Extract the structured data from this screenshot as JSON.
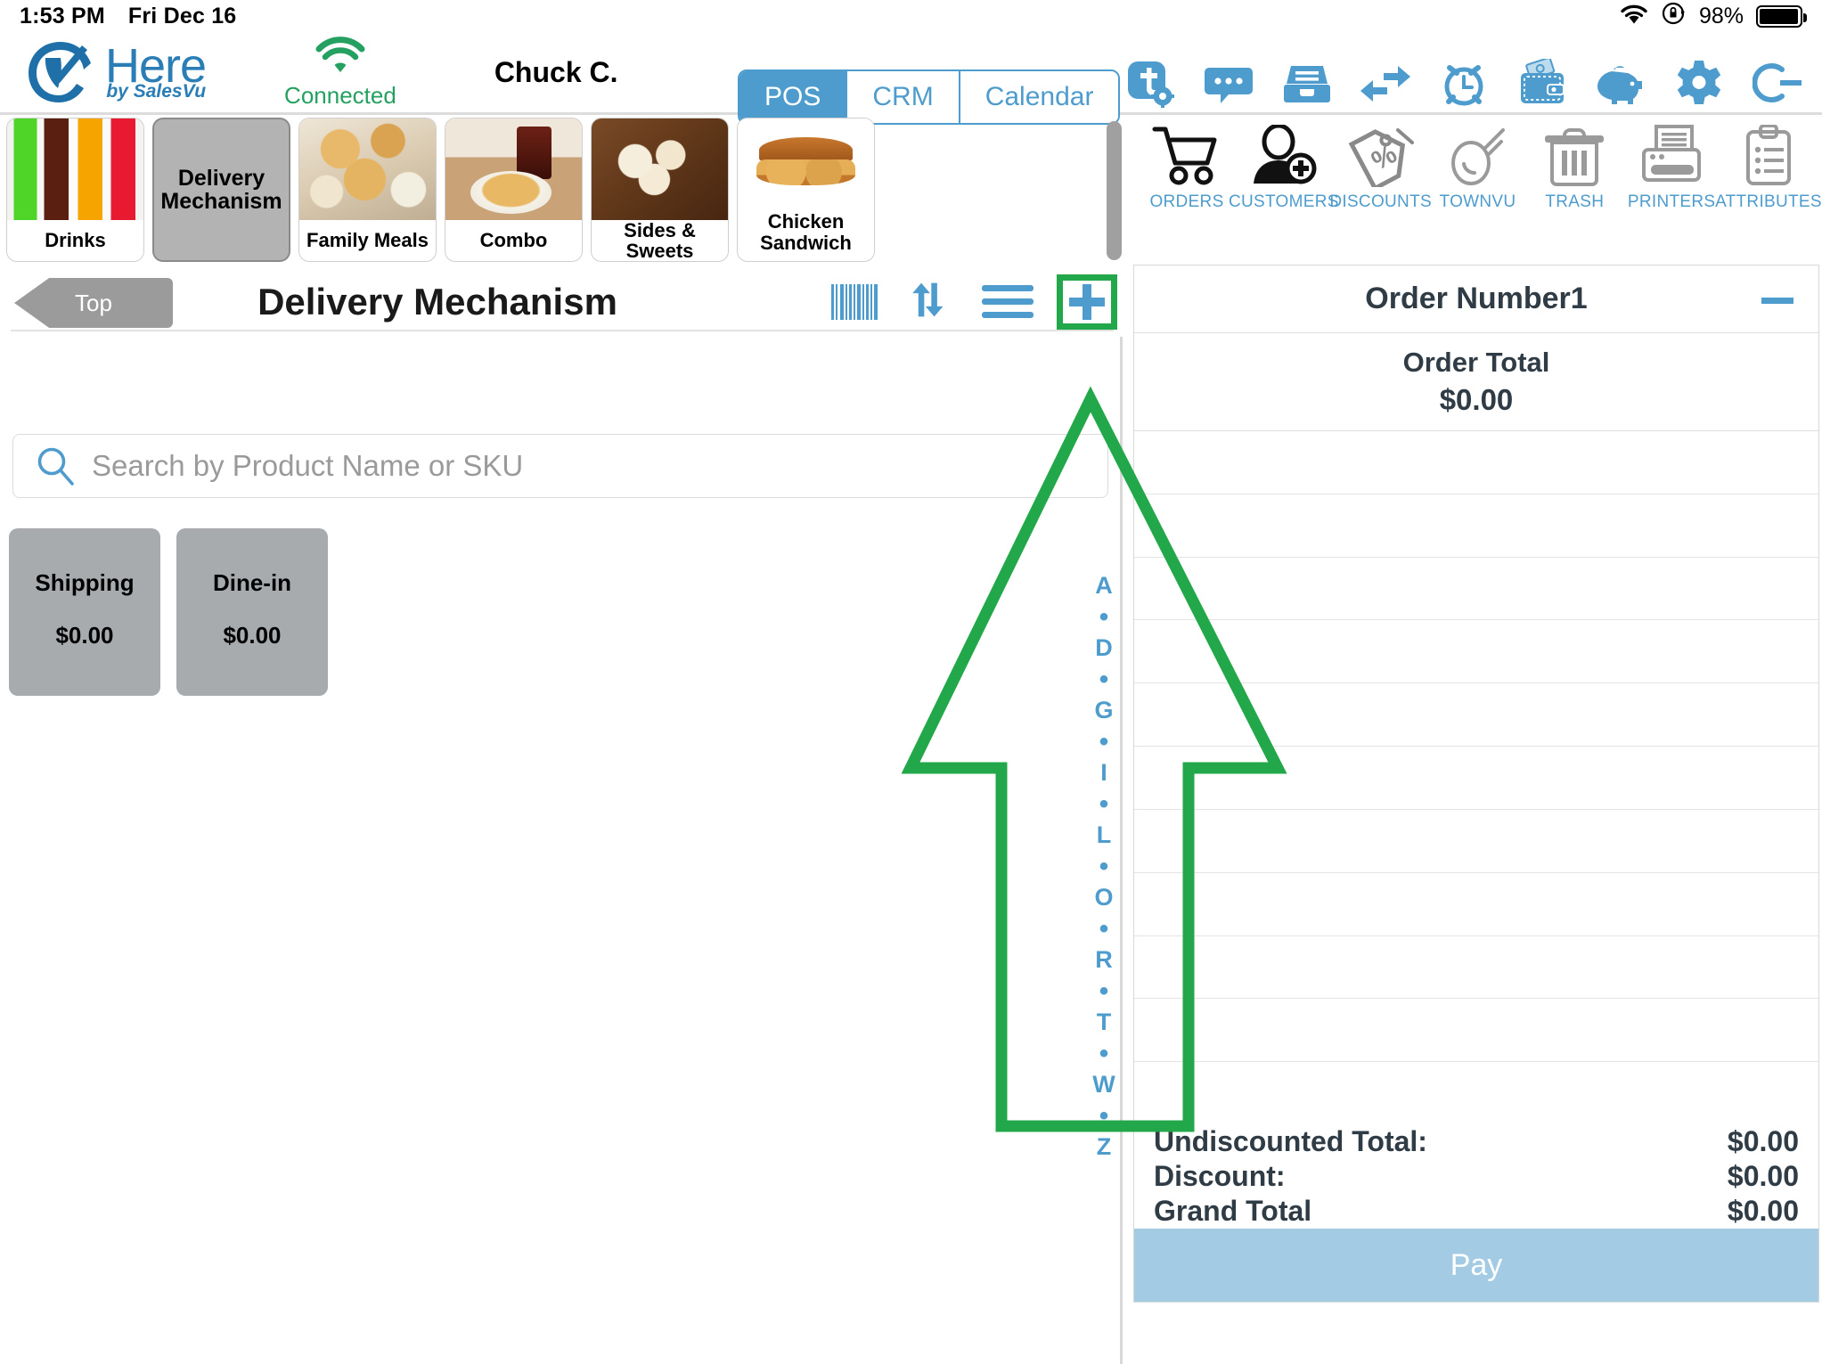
{
  "status_bar": {
    "time": "1:53 PM",
    "date": "Fri Dec 16",
    "battery_percent": "98%",
    "wifi_icon": "wifi-icon",
    "lock_rotation_icon": "rotation-lock-icon",
    "battery_icon": "battery-icon"
  },
  "header": {
    "logo_primary": "Here",
    "logo_secondary": "by SalesVu",
    "connection_status": "Connected",
    "connection_icon": "wifi-icon",
    "user_name": "Chuck C.",
    "tabs": [
      {
        "label": "POS",
        "active": true
      },
      {
        "label": "CRM",
        "active": false
      },
      {
        "label": "Calendar",
        "active": false
      }
    ],
    "icons": [
      "townvu-t-gear-icon",
      "chat-bubble-icon",
      "file-drawer-icon",
      "transfer-arrows-icon",
      "alarm-clock-icon",
      "wallet-cash-icon",
      "piggy-bank-icon",
      "settings-gear-icon",
      "logout-icon"
    ]
  },
  "categories": [
    {
      "label": "Drinks",
      "selected": false,
      "art": "art-drinks"
    },
    {
      "label": "Delivery Mechanism",
      "selected": true,
      "art": ""
    },
    {
      "label": "Family Meals",
      "selected": false,
      "art": "art-family"
    },
    {
      "label": "Combo",
      "selected": false,
      "art": "art-combo"
    },
    {
      "label": "Sides & Sweets",
      "selected": false,
      "art": "art-sweets"
    },
    {
      "label": "Chicken Sandwich",
      "selected": false,
      "art": "art-sandwich"
    }
  ],
  "section": {
    "top_button": "Top",
    "title": "Delivery Mechanism",
    "tools": [
      {
        "name": "barcode-icon",
        "highlighted": false
      },
      {
        "name": "sort-updown-icon",
        "highlighted": false
      },
      {
        "name": "list-lines-icon",
        "highlighted": false
      },
      {
        "name": "add-plus-icon",
        "highlighted": true
      }
    ]
  },
  "search": {
    "placeholder": "Search by Product Name or SKU",
    "value": "",
    "icon": "search-icon"
  },
  "products": [
    {
      "name": "Shipping",
      "price": "$0.00"
    },
    {
      "name": "Dine-in",
      "price": "$0.00"
    }
  ],
  "alphabet_index": [
    "A",
    "•",
    "D",
    "•",
    "G",
    "•",
    "I",
    "•",
    "L",
    "•",
    "O",
    "•",
    "R",
    "•",
    "T",
    "•",
    "W",
    "•",
    "Z"
  ],
  "right_toolbar": [
    {
      "label": "ORDERS",
      "icon": "shopping-cart-icon"
    },
    {
      "label": "CUSTOMERS",
      "icon": "add-customer-icon"
    },
    {
      "label": "DISCOUNTS",
      "icon": "discount-tag-icon"
    },
    {
      "label": "TOWNVU",
      "icon": "townvu-icon"
    },
    {
      "label": "TRASH",
      "icon": "trash-icon"
    },
    {
      "label": "PRINTERS",
      "icon": "printer-icon"
    },
    {
      "label": "ATTRIBUTES",
      "icon": "clipboard-icon"
    }
  ],
  "order_panel": {
    "order_number": "Order Number1",
    "collapse_icon": "minus-icon",
    "order_total_label": "Order Total",
    "order_total_value": "$0.00",
    "line_items": [],
    "empty_row_count": 11,
    "summary": [
      {
        "label": "Undiscounted Total:",
        "value": "$0.00"
      },
      {
        "label": "Discount:",
        "value": "$0.00"
      },
      {
        "label": "Grand Total",
        "value": "$0.00"
      }
    ],
    "pay_button": "Pay"
  },
  "annotation": {
    "type": "arrow-up",
    "color": "#22a84a",
    "points_to": "add-plus-icon"
  },
  "colors": {
    "brand_blue": "#2a7db5",
    "accent_blue": "#4e9ccd",
    "connected_green": "#24a060",
    "annotation_green": "#22a84a",
    "tile_gray": "#a7abae",
    "pay_blue": "#a3cbe4"
  }
}
